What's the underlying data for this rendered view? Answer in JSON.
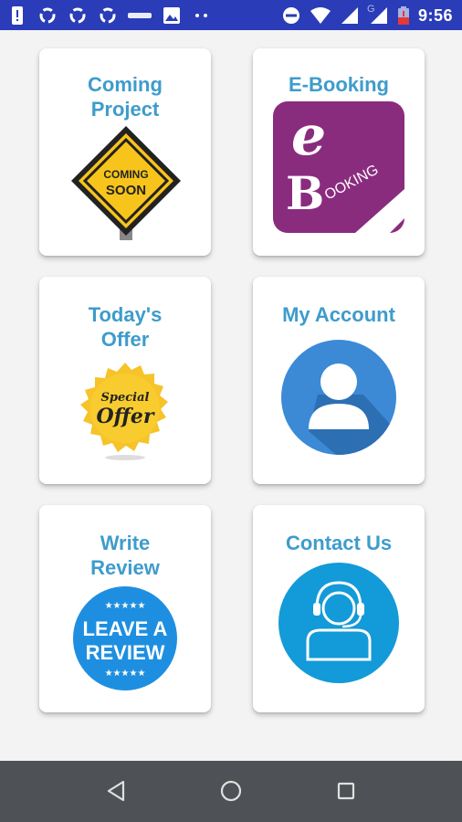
{
  "status_bar": {
    "time": "9:56",
    "left_icons": [
      "alert-icon",
      "sync-icon",
      "sync-icon",
      "sync-icon",
      "app-icon",
      "image-icon",
      "more-dots-icon"
    ],
    "right_icons": [
      "do-not-disturb-icon",
      "wifi-icon",
      "signal-icon",
      "signal-icon",
      "battery-low-icon"
    ],
    "network_letter": "G"
  },
  "menu": [
    {
      "id": "coming-project",
      "label": "Coming Project",
      "image_text": [
        "COMING",
        "SOON"
      ],
      "icon": "coming-soon-sign-icon"
    },
    {
      "id": "e-booking",
      "label": "E-Booking",
      "image_text": [
        "e",
        "B",
        "OOKING"
      ],
      "icon": "e-booking-icon"
    },
    {
      "id": "todays-offer",
      "label": "Today's Offer",
      "image_text": [
        "Special",
        "Offer"
      ],
      "icon": "special-offer-badge-icon"
    },
    {
      "id": "my-account",
      "label": "My Account",
      "icon": "user-avatar-icon"
    },
    {
      "id": "write-review",
      "label": "Write Review",
      "image_text": [
        "LEAVE A",
        "REVIEW"
      ],
      "icon": "leave-review-badge-icon"
    },
    {
      "id": "contact-us",
      "label": "Contact Us",
      "icon": "headset-agent-icon"
    }
  ],
  "colors": {
    "status_bar": "#2a3cb8",
    "title": "#3e9ccb",
    "nav_bar": "#4e5155"
  },
  "nav": [
    "back-icon",
    "home-icon",
    "recents-icon"
  ]
}
